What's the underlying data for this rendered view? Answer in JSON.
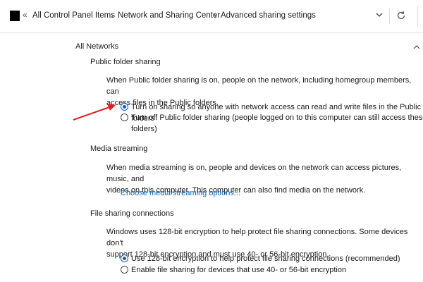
{
  "breadcrumb": {
    "overflow": "«",
    "items": [
      "All Control Panel Items",
      "Network and Sharing Center",
      "Advanced sharing settings"
    ],
    "separator": "›"
  },
  "section": {
    "title": "All Networks"
  },
  "public_folder": {
    "heading": "Public folder sharing",
    "description_line1": "When Public folder sharing is on, people on the network, including homegroup members, can",
    "description_line2": "access files in the Public folders.",
    "options": [
      {
        "label": "Turn on sharing so anyone with network access can read and write files in the Public folders",
        "checked": true
      },
      {
        "label": "Turn off Public folder sharing (people logged on to this computer can still access these folders)",
        "checked": false
      }
    ]
  },
  "media_streaming": {
    "heading": "Media streaming",
    "description_line1": "When media streaming is on, people and devices on the network can access pictures, music, and",
    "description_line2": "videos on this computer. This computer can also find media on the network.",
    "link": "Choose media streaming options..."
  },
  "file_sharing": {
    "heading": "File sharing connections",
    "description_line1": "Windows uses 128-bit encryption to help protect file sharing connections. Some devices don't",
    "description_line2": "support 128-bit encryption and must use 40- or 56-bit encryption.",
    "options": [
      {
        "label": "Use 128-bit encryption to help protect file sharing connections (recommended)",
        "checked": true
      },
      {
        "label": "Enable file sharing for devices that use 40- or 56-bit encryption",
        "checked": false
      }
    ]
  },
  "colors": {
    "accent": "#0067c0",
    "arrow": "#e02020"
  },
  "icons": {
    "app": "control-panel-icon",
    "dropdown": "chevron-down-icon",
    "refresh": "refresh-icon",
    "collapse": "chevron-up-icon"
  }
}
